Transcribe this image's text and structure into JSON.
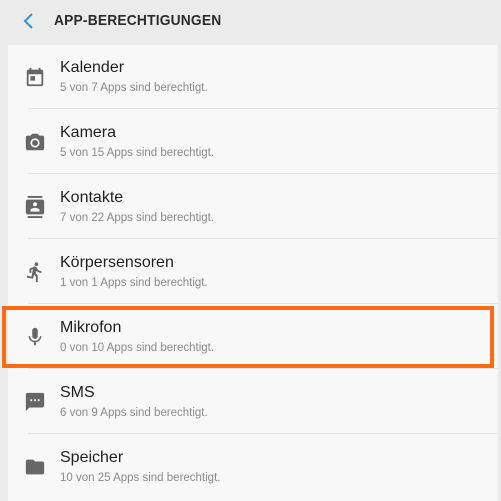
{
  "header": {
    "title": "APP-BERECHTIGUNGEN"
  },
  "permissions": [
    {
      "label": "Kalender",
      "sub": "5 von 7 Apps sind berechtigt.",
      "icon": "calendar-icon"
    },
    {
      "label": "Kamera",
      "sub": "5 von 15 Apps sind berechtigt.",
      "icon": "camera-icon"
    },
    {
      "label": "Kontakte",
      "sub": "7 von 22 Apps sind berechtigt.",
      "icon": "contacts-icon"
    },
    {
      "label": "Körpersensoren",
      "sub": "1 von 1 Apps sind berechtigt.",
      "icon": "body-sensor-icon"
    },
    {
      "label": "Mikrofon",
      "sub": "0 von 10 Apps sind berechtigt.",
      "icon": "microphone-icon"
    },
    {
      "label": "SMS",
      "sub": "6 von 9 Apps sind berechtigt.",
      "icon": "sms-icon"
    },
    {
      "label": "Speicher",
      "sub": "10 von 25 Apps sind berechtigt.",
      "icon": "folder-icon"
    }
  ],
  "colors": {
    "highlight": "#ff6a13",
    "back_arrow": "#2f8fd8"
  }
}
